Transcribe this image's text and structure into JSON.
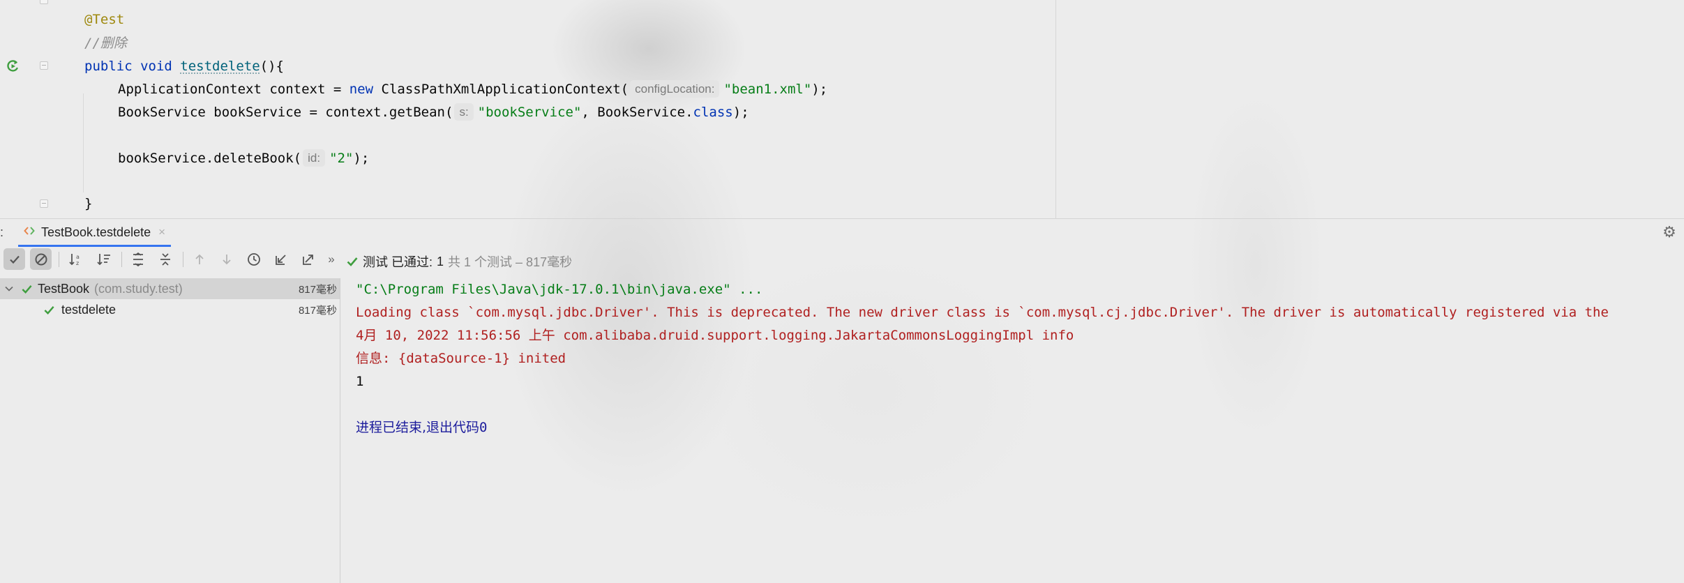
{
  "editor": {
    "lines": {
      "annotation": "@Test",
      "comment": "//删除",
      "sig_kw": "public void ",
      "sig_method": "testdelete",
      "sig_rest": "(){",
      "l4_a": "ApplicationContext context = ",
      "l4_kw": "new",
      "l4_b": " ClassPathXmlApplicationContext(",
      "l4_hint": "configLocation:",
      "l4_str": "\"bean1.xml\"",
      "l4_end": ");",
      "l5_a": "BookService bookService = context.getBean(",
      "l5_hint": "s:",
      "l5_str": "\"bookService\"",
      "l5_b": ", BookService.",
      "l5_kw": "class",
      "l5_end": ");",
      "l7_a": "bookService.deleteBook(",
      "l7_hint": "id:",
      "l7_str": "\"2\"",
      "l7_end": ");",
      "close": "}"
    }
  },
  "tool_window": {
    "tab_prefix": ":",
    "tab_title": "TestBook.testdelete",
    "tab_close": "×",
    "status_label": "测试 已通过:",
    "status_count": "1",
    "status_detail": "共 1 个测试 – 817毫秒"
  },
  "tree": {
    "root_name": "TestBook",
    "root_pkg": "(com.study.test)",
    "root_duration": "817毫秒",
    "child_name": "testdelete",
    "child_duration": "817毫秒"
  },
  "console": {
    "cmd": "\"C:\\Program Files\\Java\\jdk-17.0.1\\bin\\java.exe\" ...",
    "warn": "Loading class `com.mysql.jdbc.Driver'. This is deprecated. The new driver class is `com.mysql.cj.jdbc.Driver'. The driver is automatically registered via the",
    "log_time": "4月 10, 2022 11:56:56 ",
    "log_ampm": "上午",
    "log_class": " com.alibaba.druid.support.logging.JakartaCommonsLoggingImpl info",
    "info_label": "信息",
    "info_rest": ": {dataSource-1} inited",
    "output": "1",
    "exit_text": "进程已结束,退出代码",
    "exit_code": "0"
  },
  "colors": {
    "pass_green": "#3f9e3f",
    "keyword": "#0033b3",
    "string": "#067d17",
    "error_red": "#b02020",
    "accent": "#3574f0"
  },
  "icons": [
    "run-rerun-icon",
    "fold-icon",
    "check-icon",
    "cancel-icon",
    "sort-alpha-icon",
    "sort-duration-icon",
    "expand-all-icon",
    "collapse-all-icon",
    "arrow-up-icon",
    "arrow-down-icon",
    "history-icon",
    "import-icon",
    "export-icon",
    "more-icon",
    "gear-icon",
    "chevron-down-icon",
    "java-test-icon"
  ]
}
